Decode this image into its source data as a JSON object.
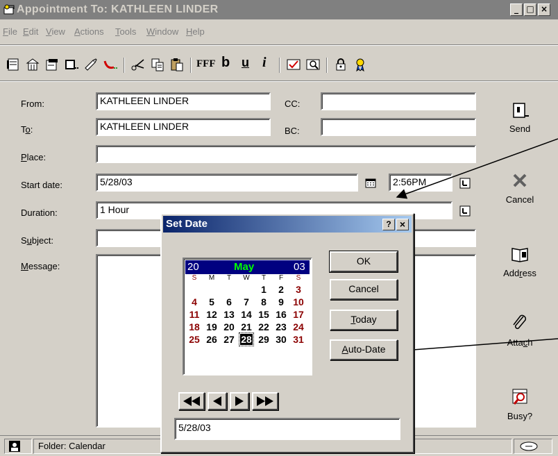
{
  "window": {
    "title": "Appointment To: KATHLEEN LINDER",
    "controls": [
      "_",
      "□",
      "×"
    ]
  },
  "menu": {
    "items": [
      {
        "label": "File",
        "key": "F",
        "rest": "ile"
      },
      {
        "label": "Edit",
        "key": "E",
        "rest": "dit"
      },
      {
        "label": "View",
        "key": "V",
        "rest": "iew"
      },
      {
        "label": "Actions",
        "key": "A",
        "rest": "ctions"
      },
      {
        "label": "Tools",
        "key": "T",
        "rest": "ools"
      },
      {
        "label": "Window",
        "key": "W",
        "rest": "indow"
      },
      {
        "label": "Help",
        "key": "H",
        "rest": "elp"
      }
    ]
  },
  "toolbar": {
    "icons": [
      "notebook-icon",
      "building-icon",
      "properties-icon",
      "screen-icon",
      "hand-pen-icon",
      "dial-icon",
      "cut-icon",
      "copy-icon",
      "paste-icon",
      "font-icon",
      "bold-icon",
      "underline-icon",
      "italic-icon",
      "spell-icon",
      "find-icon",
      "lock-icon",
      "ribbon-icon"
    ],
    "font_label": "FFF",
    "bold_label": "b",
    "underline_label": "u",
    "italic_label": "i"
  },
  "form": {
    "from_label": "From:",
    "from_value": "KATHLEEN LINDER",
    "cc_label": "CC:",
    "cc_value": "",
    "to_label_key": "o",
    "to_label_pre": "T",
    "to_label_post": ":",
    "to_value": "KATHLEEN LINDER",
    "bc_label": "BC:",
    "bc_value": "",
    "place_label_key": "P",
    "place_label_rest": "lace:",
    "place_value": "",
    "start_date_label": "Start date:",
    "start_date_value": "5/28/03",
    "start_time_value": "2:56PM",
    "duration_label": "Duration:",
    "duration_value": "1 Hour",
    "subject_label_pre": "S",
    "subject_label_key": "u",
    "subject_label_rest": "bject:",
    "subject_value": "",
    "message_label_key": "M",
    "message_label_rest": "essage:",
    "message_value": ""
  },
  "side_buttons": {
    "send": "Send",
    "cancel": "Cancel",
    "address_pre": "Add",
    "address_key": "r",
    "address_post": "ess",
    "attach_pre": "Atta",
    "attach_key": "c",
    "attach_post": "h",
    "busy": "Busy?"
  },
  "status": {
    "folder": "Folder: Calendar"
  },
  "dialog": {
    "title": "Set Date",
    "help": "?",
    "close": "×",
    "calendar": {
      "century": "20",
      "month": "May",
      "year": "03",
      "dow": [
        "S",
        "M",
        "T",
        "W",
        "T",
        "F",
        "S"
      ],
      "weeks": [
        [
          "",
          "",
          "",
          "",
          "1",
          "2",
          "3"
        ],
        [
          "4",
          "5",
          "6",
          "7",
          "8",
          "9",
          "10"
        ],
        [
          "11",
          "12",
          "13",
          "14",
          "15",
          "16",
          "17"
        ],
        [
          "18",
          "19",
          "20",
          "21",
          "22",
          "23",
          "24"
        ],
        [
          "25",
          "26",
          "27",
          "28",
          "29",
          "30",
          "31"
        ]
      ],
      "selected_day": "28",
      "colors": {
        "header_bg": "#000080",
        "month": "#00ff00",
        "weekend": "#8b0000",
        "weekday": "#000000"
      }
    },
    "buttons": {
      "ok": "OK",
      "cancel": "Cancel",
      "today_key": "T",
      "today_rest": "oday",
      "autodate_key": "A",
      "autodate_rest": "uto-Date"
    },
    "nav": [
      "rewind-icon",
      "prev-icon",
      "next-icon",
      "fast-forward-icon"
    ],
    "date_value": "5/28/03"
  }
}
